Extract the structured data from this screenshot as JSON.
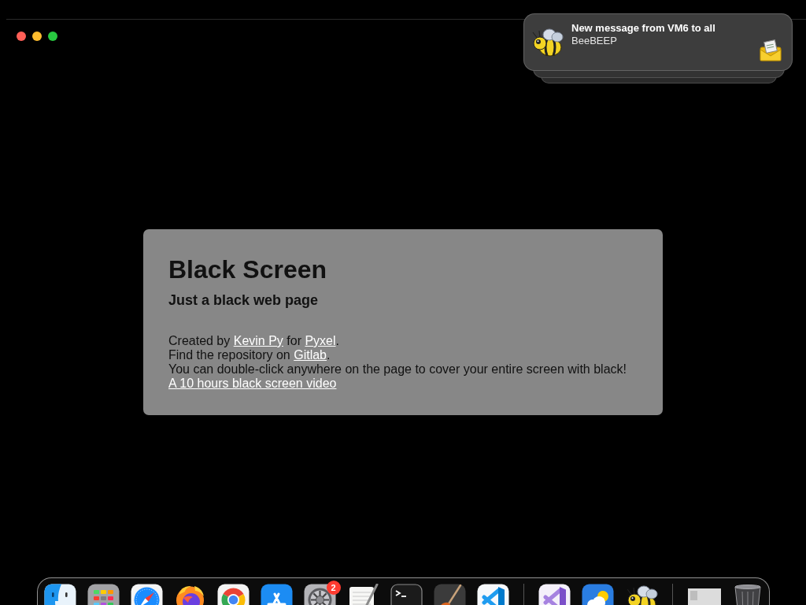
{
  "notification": {
    "title": "New message from VM6 to all",
    "app": "BeeBEEP"
  },
  "card": {
    "title": "Black Screen",
    "subtitle": "Just a black web page",
    "lines": [
      [
        {
          "kind": "text",
          "text": "Created by "
        },
        {
          "kind": "link",
          "text": "Kevin Py"
        },
        {
          "kind": "text",
          "text": " for "
        },
        {
          "kind": "link",
          "text": "Pyxel"
        },
        {
          "kind": "text",
          "text": "."
        }
      ],
      [
        {
          "kind": "text",
          "text": "Find the repository on "
        },
        {
          "kind": "link",
          "text": "Gitlab"
        },
        {
          "kind": "text",
          "text": "."
        }
      ],
      [
        {
          "kind": "text",
          "text": "You can double-click anywhere on the page to cover your entire screen with black!"
        }
      ],
      [
        {
          "kind": "link",
          "text": "A 10 hours black screen video"
        }
      ]
    ]
  },
  "dock": {
    "items": [
      {
        "kind": "finder"
      },
      {
        "kind": "launchpad"
      },
      {
        "kind": "compass"
      },
      {
        "kind": "flame"
      },
      {
        "kind": "ring"
      },
      {
        "kind": "store"
      },
      {
        "kind": "settings",
        "badge": "2"
      },
      {
        "kind": "notes"
      },
      {
        "kind": "terminal"
      },
      {
        "kind": "guitar"
      },
      {
        "kind": "ribbon"
      },
      {
        "kind": "separator"
      },
      {
        "kind": "ribbon-purple"
      },
      {
        "kind": "weather"
      },
      {
        "kind": "bee"
      },
      {
        "kind": "separator"
      },
      {
        "kind": "window"
      },
      {
        "kind": "trash"
      }
    ]
  }
}
